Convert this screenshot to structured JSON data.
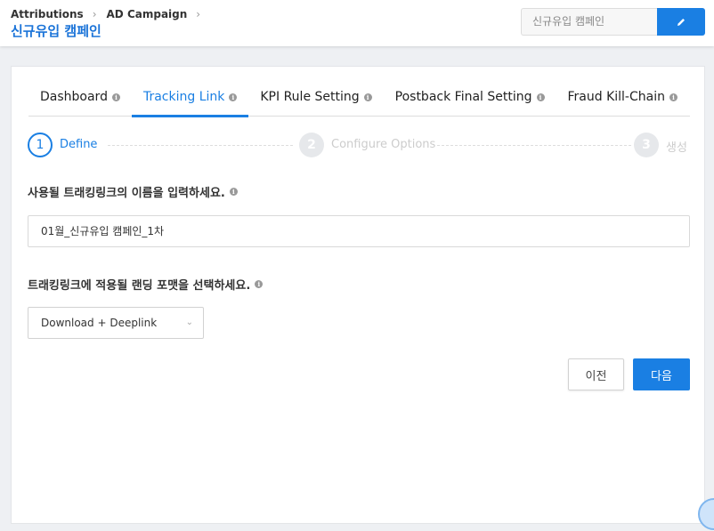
{
  "header": {
    "breadcrumb": [
      "Attributions",
      "AD Campaign"
    ],
    "title": "신규유입 캠페인",
    "campaign_name_value": "신규유입 캠페인",
    "edit_icon": "pencil-icon"
  },
  "tabs": [
    {
      "label": "Dashboard",
      "active": false
    },
    {
      "label": "Tracking Link",
      "active": true
    },
    {
      "label": "KPI Rule Setting",
      "active": false
    },
    {
      "label": "Postback Final Setting",
      "active": false
    },
    {
      "label": "Fraud Kill-Chain",
      "active": false
    }
  ],
  "stepper": {
    "steps": [
      {
        "number": "1",
        "label": "Define",
        "state": "active"
      },
      {
        "number": "2",
        "label": "Configure Options",
        "state": "inactive"
      },
      {
        "number": "3",
        "label": "생성",
        "state": "inactive"
      }
    ]
  },
  "form": {
    "name_question": "사용될 트래킹링크의 이름을 입력하세요.",
    "name_value": "01월_신규유입 캠페인_1차",
    "landing_question": "트래킹링크에 적용될 랜딩 포맷을 선택하세요.",
    "landing_selected": "Download + Deeplink",
    "prev_label": "이전",
    "next_label": "다음"
  },
  "colors": {
    "accent": "#1a7fe3",
    "title": "#1a73d8"
  }
}
